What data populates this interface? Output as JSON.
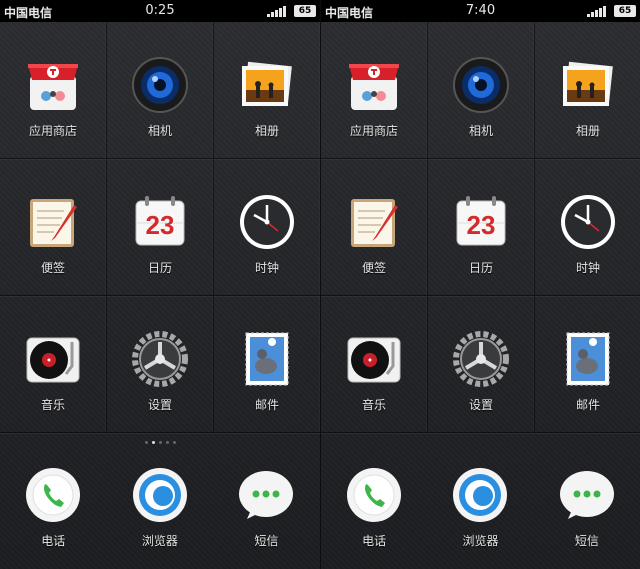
{
  "screens": [
    {
      "status": {
        "carrier": "中国电信",
        "time": "0:25",
        "battery": "65"
      },
      "apps": [
        {
          "label": "应用商店",
          "icon": "app-store-icon"
        },
        {
          "label": "相机",
          "icon": "camera-icon"
        },
        {
          "label": "相册",
          "icon": "gallery-icon"
        },
        {
          "label": "便签",
          "icon": "notes-icon"
        },
        {
          "label": "日历",
          "icon": "calendar-icon",
          "badge": "23"
        },
        {
          "label": "时钟",
          "icon": "clock-icon"
        },
        {
          "label": "音乐",
          "icon": "music-icon"
        },
        {
          "label": "设置",
          "icon": "settings-icon"
        },
        {
          "label": "邮件",
          "icon": "mail-icon"
        }
      ],
      "dock": [
        {
          "label": "电话",
          "icon": "phone-icon"
        },
        {
          "label": "浏览器",
          "icon": "browser-icon"
        },
        {
          "label": "短信",
          "icon": "messages-icon"
        }
      ]
    },
    {
      "status": {
        "carrier": "中国电信",
        "time": "7:40",
        "battery": "65"
      },
      "apps": [
        {
          "label": "应用商店",
          "icon": "app-store-icon"
        },
        {
          "label": "相机",
          "icon": "camera-icon"
        },
        {
          "label": "相册",
          "icon": "gallery-icon"
        },
        {
          "label": "便签",
          "icon": "notes-icon"
        },
        {
          "label": "日历",
          "icon": "calendar-icon",
          "badge": "23"
        },
        {
          "label": "时钟",
          "icon": "clock-icon"
        },
        {
          "label": "音乐",
          "icon": "music-icon"
        },
        {
          "label": "设置",
          "icon": "settings-icon"
        },
        {
          "label": "邮件",
          "icon": "mail-icon"
        }
      ],
      "dock": [
        {
          "label": "电话",
          "icon": "phone-icon"
        },
        {
          "label": "浏览器",
          "icon": "browser-icon"
        },
        {
          "label": "短信",
          "icon": "messages-icon"
        }
      ]
    }
  ],
  "page_indicator": {
    "pages": 5,
    "active": 1
  }
}
